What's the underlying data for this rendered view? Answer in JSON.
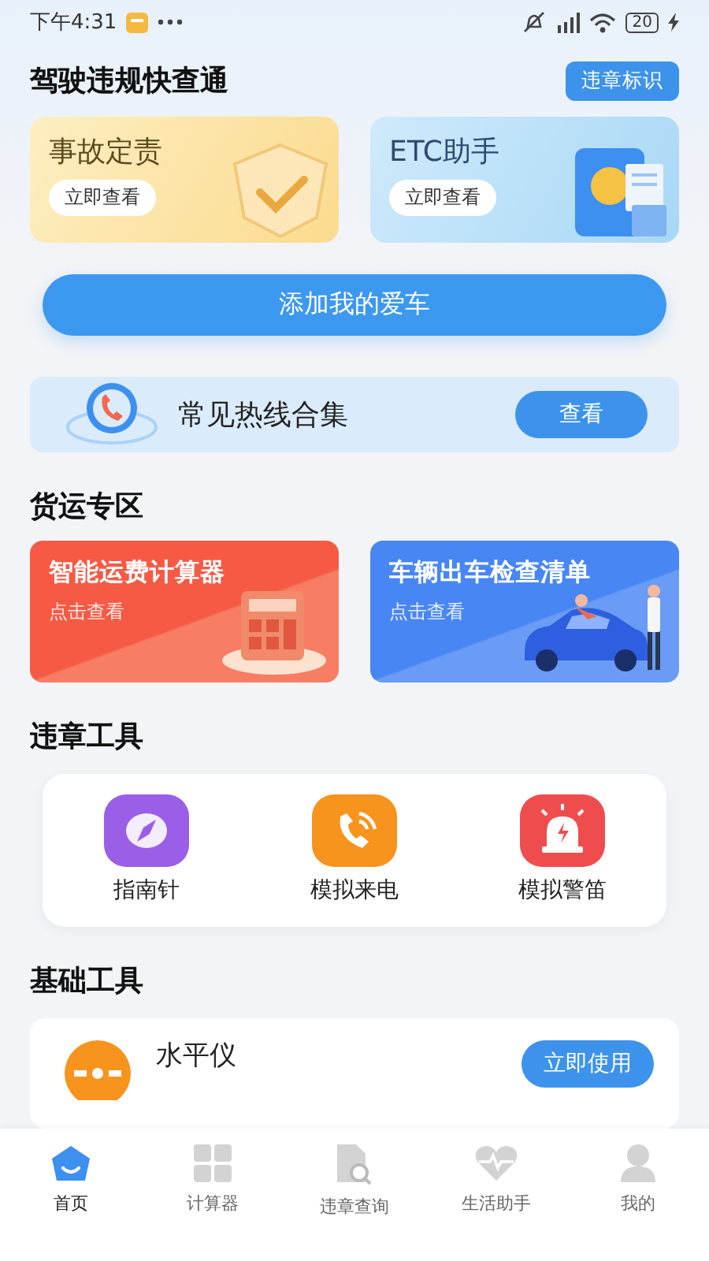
{
  "status_bar": {
    "time": "下午4:31",
    "battery": "20"
  },
  "quick_check": {
    "title": "驾驶违规快查通",
    "badge": "违章标识",
    "cards": [
      {
        "kind": "accident",
        "title": "事故定责",
        "button": "立即查看"
      },
      {
        "kind": "etc",
        "title": "ETC助手",
        "button": "立即查看"
      }
    ]
  },
  "add_car_button": "添加我的爱车",
  "hotline": {
    "title": "常见热线合集",
    "button": "查看"
  },
  "freight": {
    "title": "货运专区",
    "cards": [
      {
        "kind": "calculator",
        "title": "智能运费计算器",
        "subtitle": "点击查看"
      },
      {
        "kind": "checklist",
        "title": "车辆出车检查清单",
        "subtitle": "点击查看"
      }
    ]
  },
  "violation_tools": {
    "title": "违章工具",
    "items": [
      {
        "kind": "compass",
        "label": "指南针"
      },
      {
        "kind": "call",
        "label": "模拟来电"
      },
      {
        "kind": "siren",
        "label": "模拟警笛"
      }
    ]
  },
  "basic_tools": {
    "title": "基础工具",
    "items": [
      {
        "kind": "level",
        "name": "水平仪",
        "button": "立即使用"
      }
    ]
  },
  "tab_bar": [
    {
      "kind": "home",
      "label": "首页",
      "selected": true
    },
    {
      "kind": "calc",
      "label": "计算器",
      "selected": false
    },
    {
      "kind": "query",
      "label": "违章查询",
      "selected": false
    },
    {
      "kind": "life",
      "label": "生活助手",
      "selected": false
    },
    {
      "kind": "me",
      "label": "我的",
      "selected": false
    }
  ]
}
